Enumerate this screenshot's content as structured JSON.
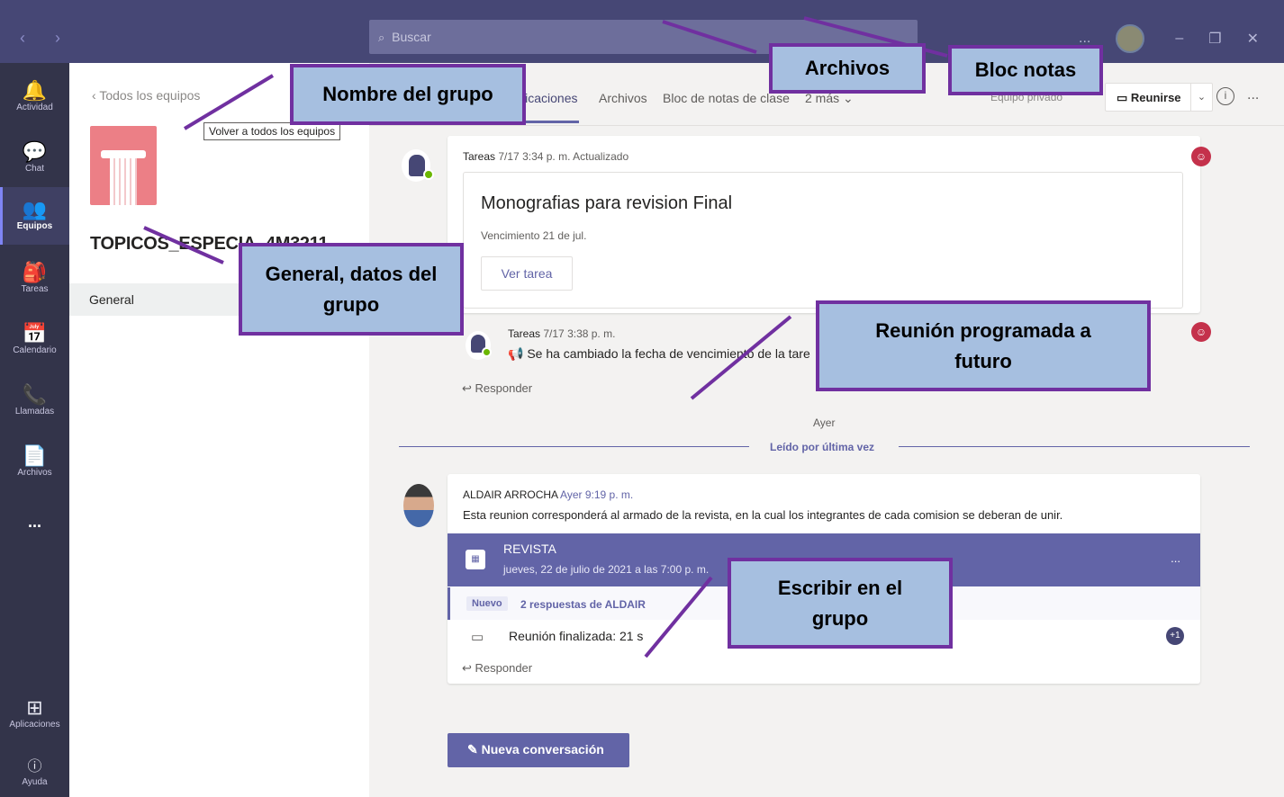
{
  "topbar": {
    "search_placeholder": "Buscar",
    "more": "...",
    "minimize": "–",
    "restore": "❐",
    "close": "✕"
  },
  "rail": [
    {
      "label": "Actividad",
      "icon": "bell-icon",
      "glyph": "🔔"
    },
    {
      "label": "Chat",
      "icon": "chat-icon",
      "glyph": "💬"
    },
    {
      "label": "Equipos",
      "icon": "teams-icon",
      "glyph": "👥"
    },
    {
      "label": "Tareas",
      "icon": "assignments-icon",
      "glyph": "🎒"
    },
    {
      "label": "Calendario",
      "icon": "calendar-icon",
      "glyph": "📅"
    },
    {
      "label": "Llamadas",
      "icon": "phone-icon",
      "glyph": "📞"
    },
    {
      "label": "Archivos",
      "icon": "file-icon",
      "glyph": "📄"
    },
    {
      "label": "...",
      "icon": "more-icon",
      "glyph": ""
    },
    {
      "label": "Aplicaciones",
      "icon": "apps-icon",
      "glyph": "⊞"
    },
    {
      "label": "Ayuda",
      "icon": "help-icon",
      "glyph": "?"
    }
  ],
  "team_panel": {
    "back_label": "Todos los equipos",
    "tooltip": "Volver a todos los equipos",
    "team_name": "TOPICOS_ESPECIA_4M3211",
    "team_more": "...",
    "channel": "General"
  },
  "tabs": {
    "items": [
      "licaciones",
      "Archivos",
      "Bloc de notas de clase",
      "2 más ⌄"
    ],
    "private_badge": "Equipo privado",
    "meet_label": "Reunirse",
    "info": "i",
    "more": "..."
  },
  "posts": {
    "task1": {
      "meta_app": "Tareas",
      "meta_time": "7/17 3:34 p. m.",
      "meta_status": "Actualizado",
      "title": "Monografias para revision Final",
      "due": "Vencimiento 21 de jul.",
      "button": "Ver tarea"
    },
    "task2": {
      "meta_app": "Tareas",
      "meta_time": "7/17 3:38 p. m.",
      "text": "Se ha cambiado la fecha de vencimiento de la tare",
      "reply": "Responder"
    },
    "separator": "Ayer",
    "last_read": "Leído por última vez",
    "meeting_post": {
      "author": "ALDAIR ARROCHA",
      "time": "Ayer 9:19 p. m.",
      "text": "Esta reunion corresponderá al armado de la revista, en la cual los integrantes de cada comision se deberan de unir.",
      "meeting_title": "REVISTA",
      "meeting_date": "jueves, 22 de julio de 2021 a las 7:00 p. m.",
      "meeting_more": "...",
      "new_badge": "Nuevo",
      "replies": "2 respuestas de ALDAIR",
      "ended": "Reunión finalizada: 21 s",
      "plus_count": "+1",
      "reply": "Responder"
    }
  },
  "new_conversation": "Nueva conversación",
  "callouts": {
    "group_name": "Nombre del grupo",
    "files": "Archivos",
    "notebook": "Bloc notas",
    "general": "General, datos del grupo",
    "future_meeting": "Reunión programada a futuro",
    "write": "Escribir en el grupo"
  },
  "colors": {
    "brand": "#6264a7",
    "topbar": "#464775",
    "rail": "#33344a",
    "callout_fill": "#a6bfe0",
    "callout_border": "#7030a0"
  }
}
